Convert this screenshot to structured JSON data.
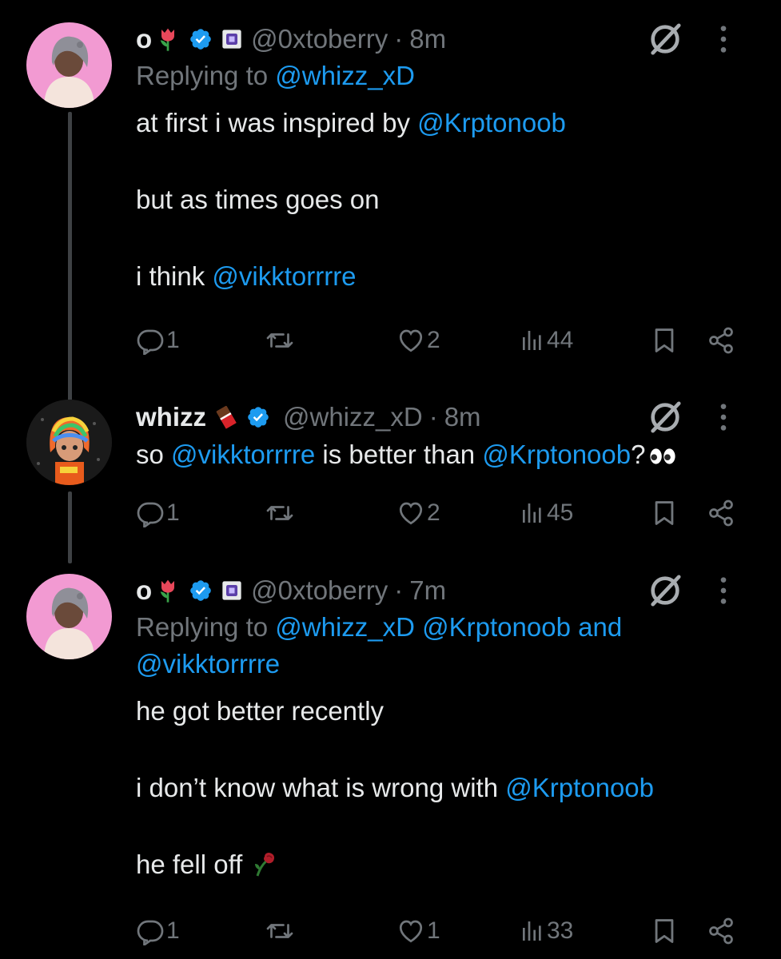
{
  "tweets": [
    {
      "name": "o",
      "name_emoji": "tulip-emoji",
      "handle": "@0xtoberry",
      "sep": "·",
      "time": "8m",
      "replying_prefix": "Replying to ",
      "replying_to": [
        "@whizz_xD"
      ],
      "body": {
        "line1_text": "at first i was inspired by ",
        "line1_mention": "@Krptonoob",
        "line2": "but as times goes on",
        "line3_text": "i think ",
        "line3_mention": "@vikktorrrre"
      },
      "stats": {
        "replies": "1",
        "likes": "2",
        "views": "44"
      }
    },
    {
      "name": "whizz",
      "name_emoji": "chocolate-emoji",
      "handle": "@whizz_xD",
      "sep": "·",
      "time": "8m",
      "body": {
        "t1": "so ",
        "m1": "@vikktorrrre",
        "t2": " is better than ",
        "m2": "@Krptonoob",
        "t3": "?"
      },
      "stats": {
        "replies": "1",
        "likes": "2",
        "views": "45"
      }
    },
    {
      "name": "o",
      "name_emoji": "tulip-emoji",
      "handle": "@0xtoberry",
      "sep": "·",
      "time": "7m",
      "replying_prefix": "Replying to ",
      "replying_m1": "@whizz_xD",
      "replying_m2": "@Krptonoob",
      "replying_and": "and",
      "replying_m3": "@vikktorrrre",
      "body": {
        "line1": "he got better recently",
        "line2_text": "i don’t know what is wrong with ",
        "line2_mention": "@Krptonoob",
        "line3": "he fell off"
      },
      "stats": {
        "replies": "1",
        "likes": "1",
        "views": "33"
      }
    }
  ],
  "colors": {
    "background": "#000000",
    "text": "#e7e9ea",
    "muted": "#71767b",
    "accent": "#1d9bf0",
    "verified": "#1d9bf0"
  }
}
